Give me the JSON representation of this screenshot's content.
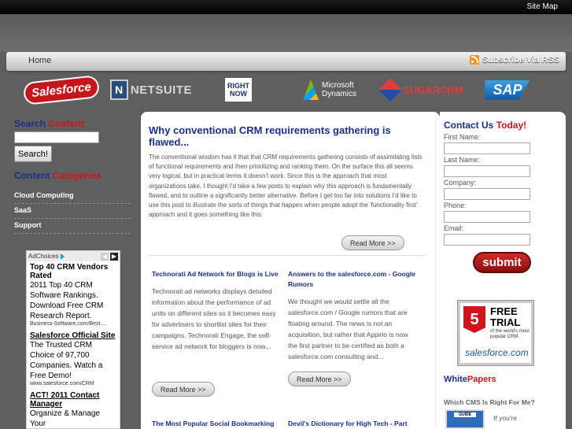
{
  "topbar": {
    "sitemap": "Site Map"
  },
  "nav": {
    "home": "Home",
    "rss": "Subscribe Via RSS"
  },
  "logos": {
    "salesforce": "Salesforce",
    "netsuite_box": "N",
    "netsuite": "NETSUITE",
    "rightnow_1": "RIGHT",
    "rightnow_2": "NOW",
    "microsoft_1": "Microsoft",
    "microsoft_2": "Dynamics",
    "sugarcrm": "SUGARCRM",
    "sap": "SAP"
  },
  "left": {
    "search_head_1": "Search",
    "search_head_2": "Content",
    "search_button": "Search!",
    "cat_head_1": "Content",
    "cat_head_2": "Categories",
    "categories": [
      "Cloud Computing",
      "SaaS",
      "Support"
    ]
  },
  "ad": {
    "label": "AdChoices",
    "items": [
      {
        "title": "Top 40 CRM Vendors Rated",
        "text": "2011 Top 40 CRM Software Rankings. Download Free CRM Research Report.",
        "url": "Business-Software.com/Best..."
      },
      {
        "title": "Salesforce Official Site",
        "text": "The Trusted CRM Choice of 97,700 Companies. Watch a Free Demo!",
        "url": "www.salesforce.com/CRM"
      },
      {
        "title": "ACT! 2011 Contact Manager",
        "text": "Organize & Manage Your",
        "url": ""
      }
    ]
  },
  "featured": {
    "title": "Why conventional CRM requirements gathering is flawed...",
    "body": "The conventional wisdom has it that that CRM requirements gathering consists of assimilating lists of functional requirements and then prioritizing and ranking them. On the surface this all seems very logical, but in practical terms it doesn't work. Since this is the approach that most organizations take, I thought I'd take a few posts to explain why this approach is fundamentally flawed, and to outline a significantly better alternative. Before I get too far into solutions I'd like to use this post to illustrate the sorts of things that happen when people adopt the 'functionality first' approach and it goes something like this:",
    "readmore": "Read More >>"
  },
  "posts": [
    {
      "title": "Technorati Ad Network for Blogs is Live",
      "body": "Technorati ad networks displays detailed information about the performance of ad units on different sites so it becomes easy for advertisers to shortlist sites for their campaigns. Technorati Engage, the self-service ad network for bloggers is now...",
      "readmore": "Read More >>"
    },
    {
      "title": "Answers to the salesforce.com - Google Rumors",
      "body": "We thought we would settle all the salesforce.com / Google rumors that are floating around. The news is not an acquisition, but rather that Appirio is now the first partner to be certified as both a salesforce.com consulting and...",
      "readmore": "Read More >>"
    },
    {
      "title": "The Most Popular Social Bookmarking",
      "body": "",
      "readmore": ""
    },
    {
      "title": "Devil's Dictionary for High Tech - Part",
      "body": "",
      "readmore": ""
    }
  ],
  "right": {
    "contact_1": "Contact Us",
    "contact_2": "Today!",
    "fields": [
      "First Name:",
      "Last Name:",
      "Company:",
      "Phone:",
      "Email:"
    ],
    "submit": "submit",
    "trial_badge": "5",
    "trial_title": "FREE TRIAL",
    "trial_sub": "of the world's most popular CRM.",
    "trial_brand": "salesforce.com",
    "wp_1": "White",
    "wp_2": "Papers",
    "wp_sub": "Which CMS Is Right For Me?",
    "wp_thumb": "GUIDE",
    "wp_text": "If you're"
  },
  "colors": {
    "brand_blue": "#1c2f8a",
    "accent_red": "#d0141c",
    "background": "#5f5f5f"
  }
}
